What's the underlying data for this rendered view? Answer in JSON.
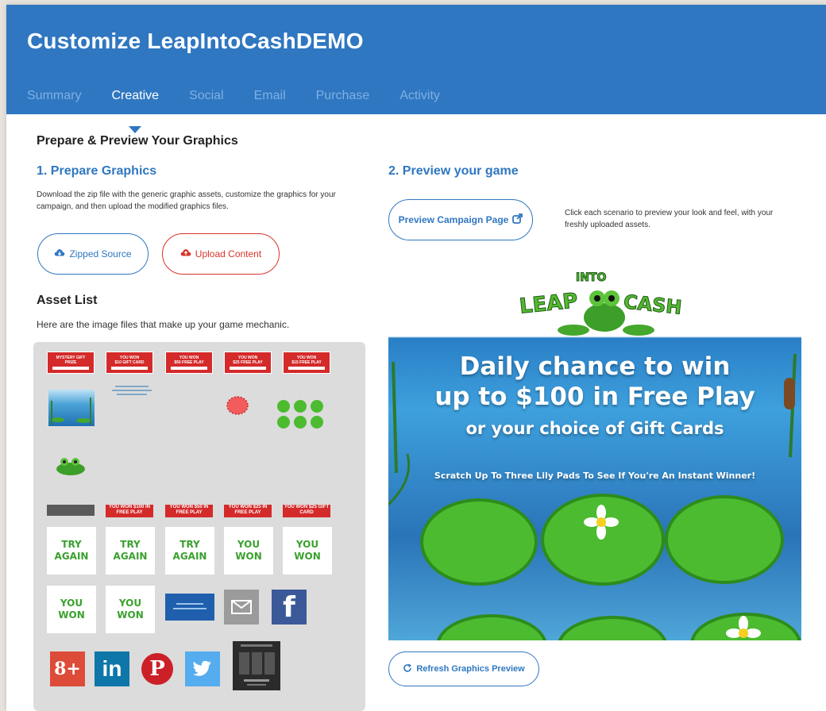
{
  "page_title": "Customize LeapIntoCashDEMO",
  "tabs": [
    {
      "label": "Summary",
      "active": false
    },
    {
      "label": "Creative",
      "active": true
    },
    {
      "label": "Social",
      "active": false
    },
    {
      "label": "Email",
      "active": false
    },
    {
      "label": "Purchase",
      "active": false
    },
    {
      "label": "Activity",
      "active": false
    }
  ],
  "section_title": "Prepare & Preview Your Graphics",
  "prepare": {
    "heading": "1. Prepare Graphics",
    "description": "Download the zip file with the generic graphic assets, customize the graphics for your campaign, and then upload the modified graphics files.",
    "zipped_source_label": "Zipped Source",
    "upload_content_label": "Upload Content"
  },
  "assets": {
    "heading": "Asset List",
    "description": "Here are the image files that make up your game mechanic.",
    "red_tickets_row1": [
      [
        "MYSTERY GIFT",
        "PRIZE"
      ],
      [
        "YOU WON",
        "$10 GIFT CARD"
      ],
      [
        "YOU WON",
        "$50 FREE PLAY"
      ],
      [
        "YOU WON",
        "$25 FREE PLAY"
      ],
      [
        "YOU WON",
        "$15 FREE PLAY"
      ]
    ],
    "red_tickets_row3": [
      "YOU WON $100 IN FREE PLAY",
      "YOU WON $50 IN FREE PLAY",
      "YOU WON $25 IN FREE PLAY",
      "YOU WON $25 GIFT CARD"
    ],
    "cards": [
      "TRY AGAIN",
      "TRY AGAIN",
      "TRY AGAIN",
      "YOU WON",
      "YOU WON",
      "YOU WON",
      "YOU WON"
    ],
    "social_icons": [
      "envelope-icon",
      "facebook-icon",
      "google-plus-icon",
      "linkedin-icon",
      "pinterest-icon",
      "twitter-icon"
    ],
    "social_glyphs": {
      "facebook": "f",
      "google_plus": "8+",
      "linkedin": "in",
      "pinterest": "P"
    }
  },
  "preview_section": {
    "heading": "2. Preview your game",
    "button_label": "Preview Campaign Page",
    "hint": "Click each scenario to preview your look and feel, with your freshly uploaded assets.",
    "refresh_label": "Refresh Graphics Preview"
  },
  "game_preview": {
    "logo_words": [
      "INTO",
      "LEAP",
      "CASH"
    ],
    "headline_line1": "Daily chance to win",
    "headline_line2": "up to $100 in Free Play",
    "headline_line3": "or your choice of Gift Cards",
    "instruction": "Scratch Up To Three Lily Pads To See If You're An Instant Winner!"
  },
  "colors": {
    "brand_blue": "#2f77c1",
    "danger_red": "#d9342b",
    "lily_green": "#4cbb30",
    "water_blue": "#2a7fc6"
  }
}
